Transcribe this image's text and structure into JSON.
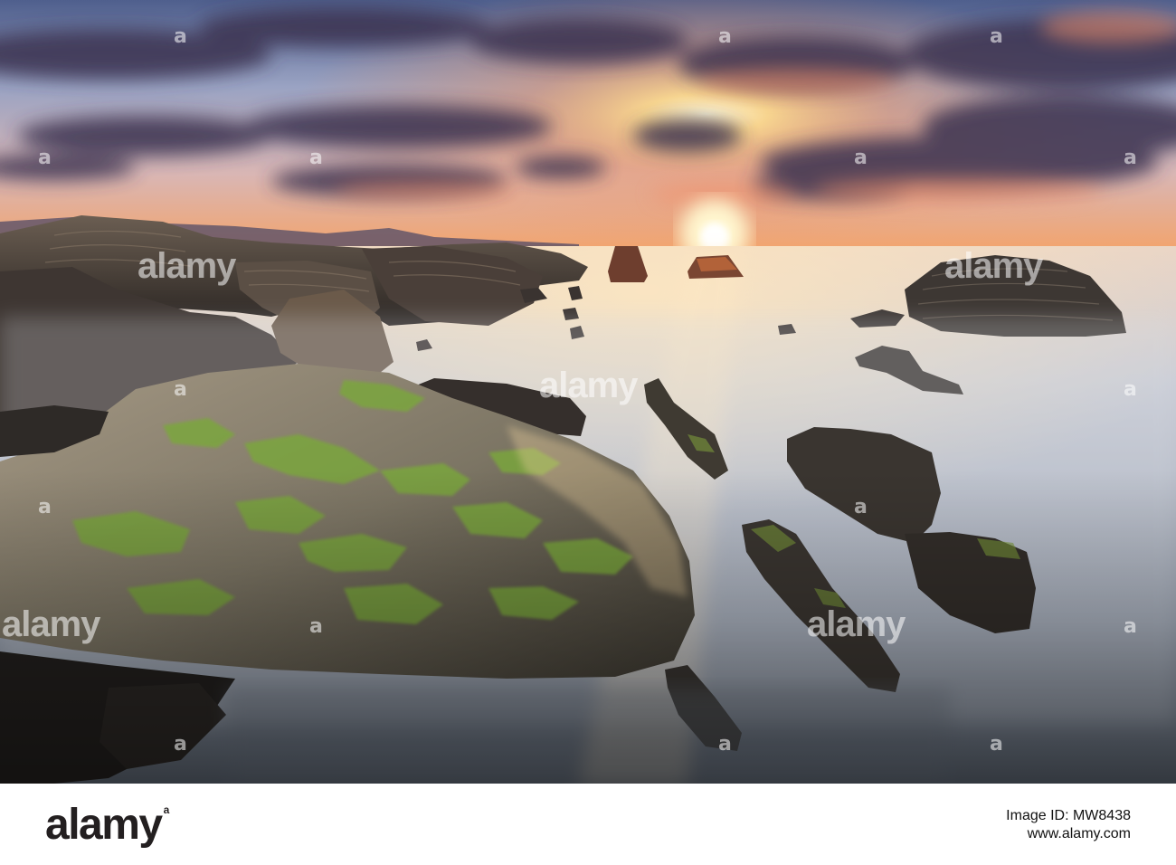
{
  "watermark": {
    "text": "alamy",
    "logo": "a"
  },
  "footer": {
    "brand": "alamy",
    "trademark": "a",
    "image_id_line": "Image ID: MW8438",
    "url_line": "www.alamy.com"
  },
  "colors": {
    "sky_top": "#5a6e9a",
    "sky_mid": "#c8b5c8",
    "sun": "#fff3c4",
    "sunset_orange": "#f08a4b",
    "cloud": "#3e3550",
    "rock": "#3a3430",
    "moss": "#7aa03a",
    "mist": "#cfd3dc"
  }
}
